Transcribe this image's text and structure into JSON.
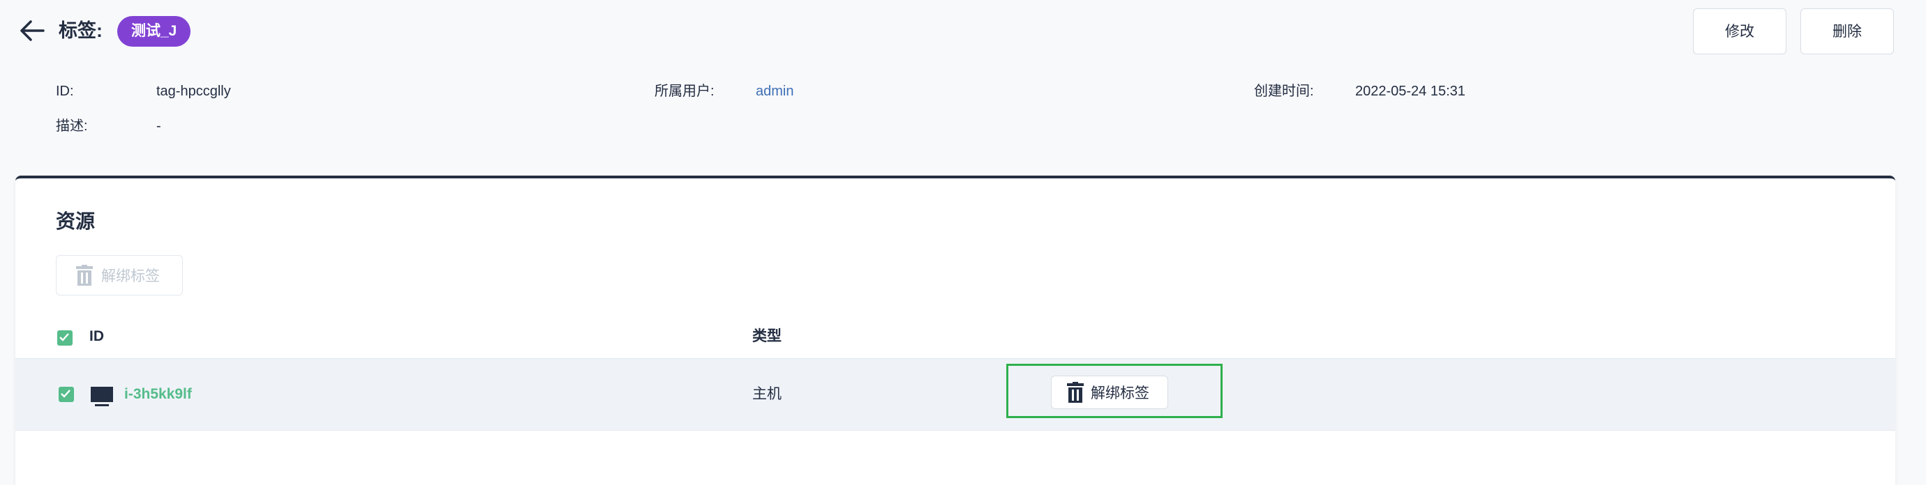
{
  "header": {
    "back_icon": "arrow-left-icon",
    "title": "标签:",
    "tag_name": "测试_J",
    "tag_color": "#8142d4",
    "edit_label": "修改",
    "delete_label": "删除"
  },
  "meta": {
    "id_label": "ID:",
    "id_value": "tag-hpccglly",
    "owner_label": "所属用户:",
    "owner_value": "admin",
    "created_label": "创建时间:",
    "created_value": "2022-05-24 15:31",
    "desc_label": "描述:",
    "desc_value": "-"
  },
  "resources": {
    "title": "资源",
    "unbind_all_label": "解绑标签",
    "columns": {
      "id": "ID",
      "type": "类型"
    },
    "rows": [
      {
        "id": "i-3h5kk9lf",
        "type": "主机",
        "icon": "host-icon",
        "action_label": "解绑标签",
        "checked": true
      }
    ]
  },
  "colors": {
    "accent_green": "#55bc8a",
    "link_blue": "#3d6fb6",
    "highlight_green": "#2fb04d"
  }
}
